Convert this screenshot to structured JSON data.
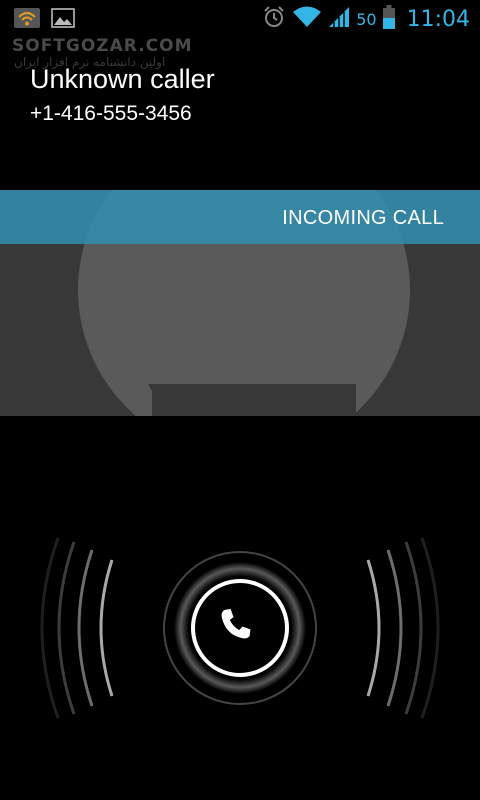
{
  "status_bar": {
    "left_icons": [
      "wifi-notification-icon",
      "gallery-notification-icon"
    ],
    "right_icons": [
      "alarm-icon",
      "wifi-signal-icon",
      "cell-signal-icon",
      "battery-icon"
    ],
    "battery_level": "50",
    "time": "11:04",
    "accent_color": "#33b5e5"
  },
  "watermark": {
    "brand": "SOFTGOZAR.COM",
    "tagline": "اولین دانشنامه نرم افزار ایران"
  },
  "caller": {
    "name": "Unknown caller",
    "number": "+1-416-555-3456"
  },
  "call_state": {
    "label": "INCOMING CALL",
    "banner_color": "#338cac"
  },
  "answer_control": {
    "icon": "phone-handset-icon"
  }
}
